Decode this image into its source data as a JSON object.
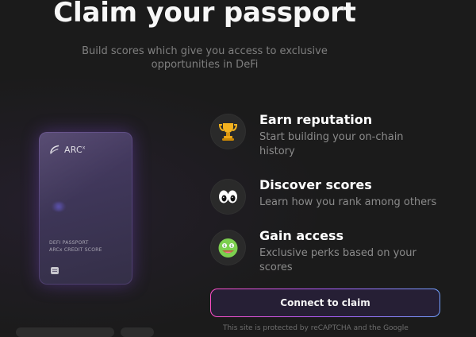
{
  "page": {
    "title": "Claim your passport",
    "subtitle": "Build scores which give you access to exclusive opportunities in DeFi"
  },
  "passport_card": {
    "brand": "ARC",
    "superscript": "x",
    "line1": "DEFI PASSPORT",
    "line2": "ARCx CREDIT SCORE"
  },
  "features": [
    {
      "icon": "trophy-icon",
      "title": "Earn reputation",
      "description": "Start building your on-chain history"
    },
    {
      "icon": "eyes-icon",
      "title": "Discover scores",
      "description": "Learn how you rank among others"
    },
    {
      "icon": "money-face-icon",
      "title": "Gain access",
      "description": "Exclusive perks based on your scores"
    }
  ],
  "actions": {
    "connect_label": "Connect to claim"
  },
  "footer": {
    "recaptcha_note": "This site is protected by reCAPTCHA and the Google"
  },
  "colors": {
    "background": "#1b1b1b",
    "accent_start": "#ff4fc8",
    "accent_mid": "#b05dff",
    "accent_end": "#73a0ff",
    "card_glow": "#7648c7"
  }
}
